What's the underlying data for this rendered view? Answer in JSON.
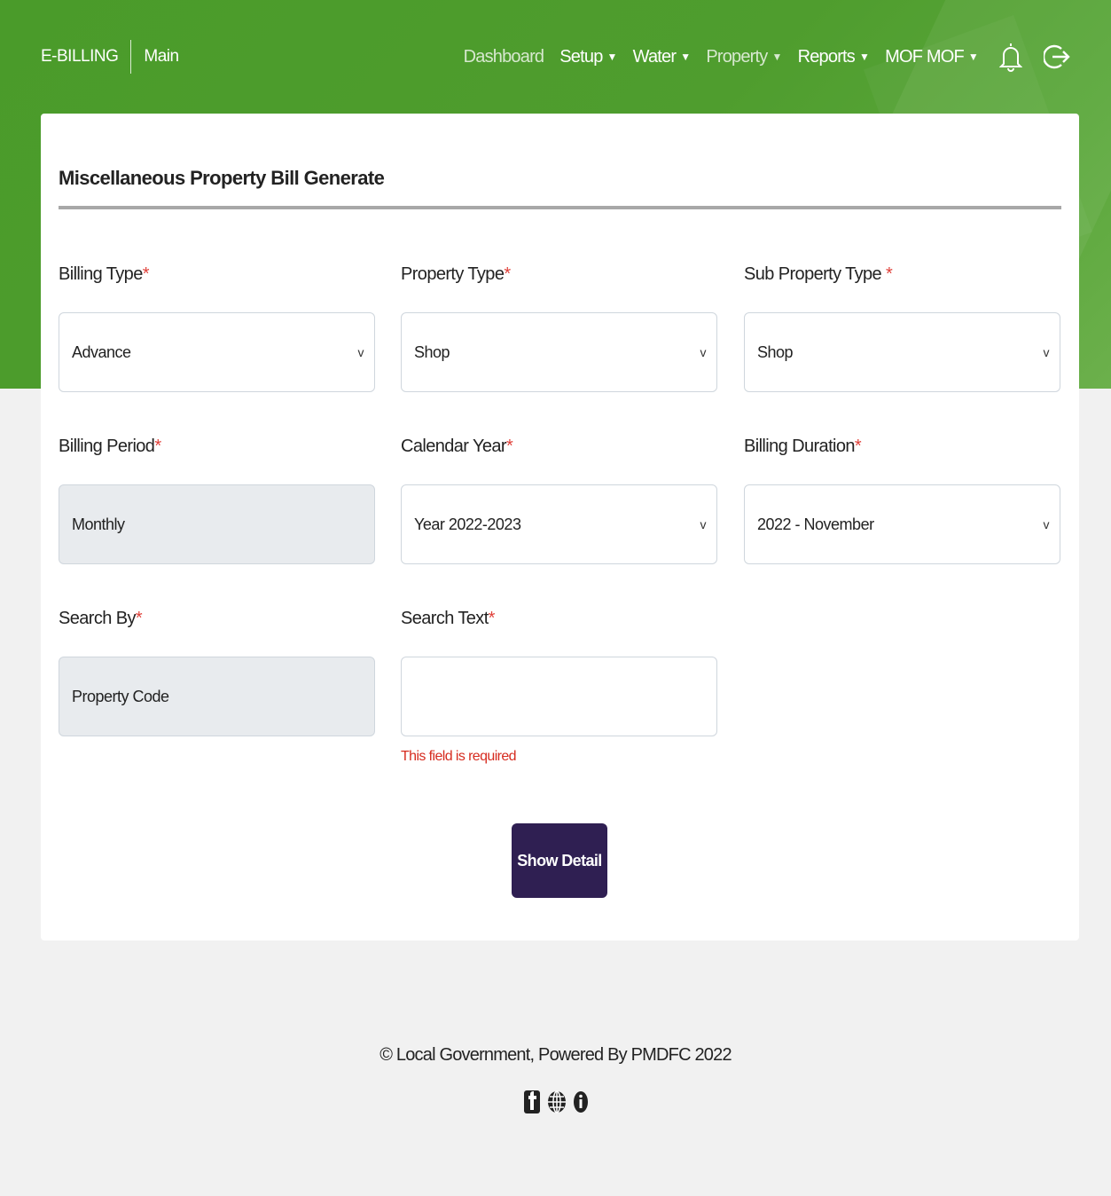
{
  "header": {
    "brand": "E-BILLING",
    "section": "Main",
    "menu": {
      "dashboard": "Dashboard",
      "setup": "Setup",
      "water": "Water",
      "property": "Property",
      "reports": "Reports",
      "user": "MOF MOF"
    },
    "icons": [
      "bell-icon",
      "logout-icon"
    ]
  },
  "form": {
    "title": "Miscellaneous Property Bill Generate",
    "billing_type": {
      "label": "Billing Type",
      "value": "Advance"
    },
    "property_type": {
      "label": "Property Type",
      "value": "Shop"
    },
    "sub_property_type": {
      "label": "Sub Property Type ",
      "value": "Shop"
    },
    "billing_period": {
      "label": "Billing Period",
      "value": "Monthly"
    },
    "calendar_year": {
      "label": "Calendar Year",
      "value": "Year 2022-2023"
    },
    "billing_duration": {
      "label": "Billing Duration",
      "value": "2022 - November"
    },
    "search_by": {
      "label": "Search By",
      "value": "Property Code"
    },
    "search_text": {
      "label": "Search Text",
      "value": "",
      "error": "This field is required"
    },
    "required_mark": "*",
    "submit_label": "Show Detail"
  },
  "footer": {
    "text": "© Local Government, Powered By PMDFC 2022",
    "social_icons": [
      "facebook-icon",
      "globe-icon",
      "info-icon"
    ]
  },
  "colors": {
    "header_green": "#4f9d2e",
    "button_purple": "#2f1f52",
    "required_red": "#e0413a",
    "error_red": "#d62b1f",
    "readonly_gray": "#e8ebee"
  }
}
